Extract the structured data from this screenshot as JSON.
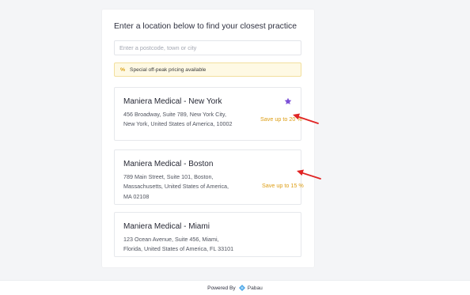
{
  "heading": "Enter a location below to find your closest practice",
  "search": {
    "placeholder": "Enter a postcode, town or city",
    "value": ""
  },
  "notice": {
    "icon": "%",
    "text": "Special off-peak pricing available"
  },
  "practices": [
    {
      "name": "Maniera Medical - New York",
      "address_line1": "456 Broadway, Suite 789, New York City,",
      "address_line2": "New York, United States of America, 10002",
      "offer": "Save up to 20 %",
      "favorite": true
    },
    {
      "name": "Maniera Medical - Boston",
      "address_line1": "789 Main Street, Suite 101, Boston,",
      "address_line2": "Massachusetts, United States of America,",
      "address_line3": "MA 02108",
      "offer": "Save up to 15 %",
      "favorite": false
    },
    {
      "name": "Maniera Medical - Miami",
      "address_line1": "123 Ocean Avenue, Suite 456, Miami,",
      "address_line2": "Florida, United States of America, FL 33101",
      "offer": "",
      "favorite": false
    }
  ],
  "footer": {
    "powered_by": "Powered By",
    "brand": "Pabau"
  },
  "colors": {
    "accent_offer": "#dd9d13",
    "star": "#7b4fd6",
    "annotation_arrow": "#e02424",
    "notice_bg": "#fef9e4",
    "brand_icon": "#4aa6e8"
  }
}
